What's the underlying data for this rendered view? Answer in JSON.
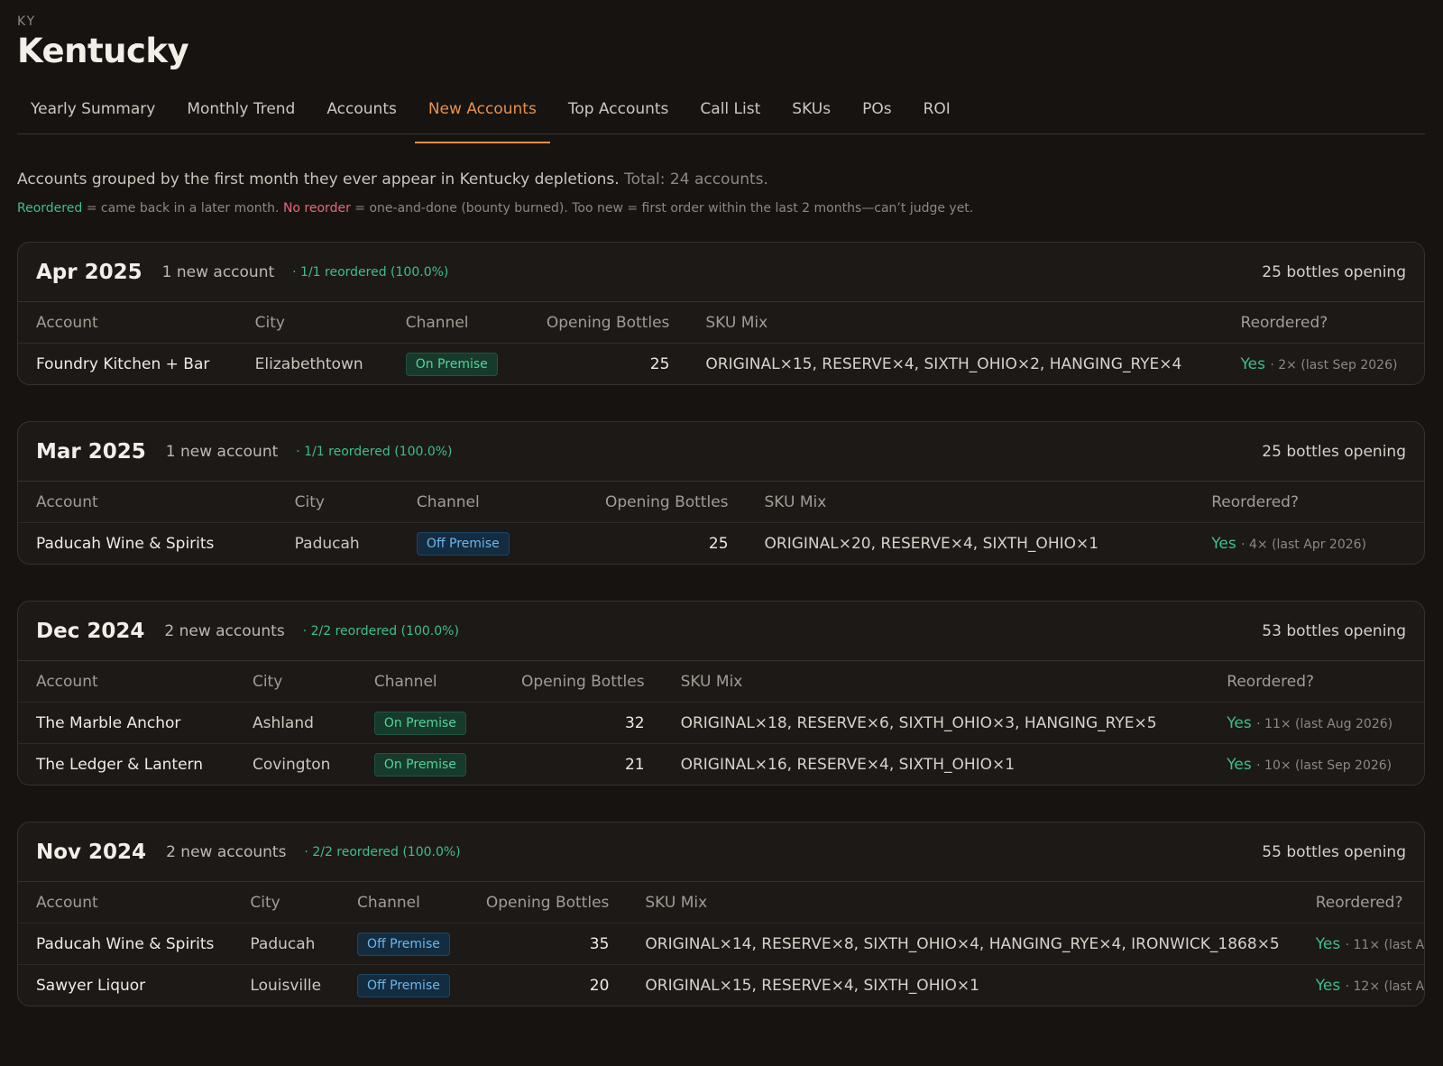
{
  "state": {
    "abbr": "KY",
    "name": "Kentucky"
  },
  "tabs": [
    {
      "label": "Yearly Summary",
      "active": false
    },
    {
      "label": "Monthly Trend",
      "active": false
    },
    {
      "label": "Accounts",
      "active": false
    },
    {
      "label": "New Accounts",
      "active": true
    },
    {
      "label": "Top Accounts",
      "active": false
    },
    {
      "label": "Call List",
      "active": false
    },
    {
      "label": "SKUs",
      "active": false
    },
    {
      "label": "POs",
      "active": false
    },
    {
      "label": "ROI",
      "active": false
    }
  ],
  "intro": {
    "text": "Accounts grouped by the first month they ever appear in Kentucky depletions.",
    "total": "Total: 24 accounts."
  },
  "legend": {
    "reordered": "Reordered",
    "reordered_desc": " = came back in a later month. ",
    "no_reorder": "No reorder",
    "no_reorder_desc": " = one-and-done (bounty burned). Too new = first order within the last 2 months—can’t judge yet."
  },
  "columns": {
    "account": "Account",
    "city": "City",
    "channel": "Channel",
    "opening": "Opening Bottles",
    "sku": "SKU Mix",
    "reordered": "Reordered?"
  },
  "colors": {
    "accent": "#e8904a",
    "green": "#3fbf87",
    "red": "#e8687a"
  },
  "groups": [
    {
      "month": "Apr 2025",
      "count": "1 new account",
      "reordered": "· 1/1 reordered (100.0%)",
      "bottles": "25 bottles opening",
      "rows": [
        {
          "account": "Foundry Kitchen + Bar",
          "city": "Elizabethtown",
          "channel": "On Premise",
          "channel_type": "on",
          "opening": "25",
          "sku": "ORIGINAL×15, RESERVE×4, SIXTH_OHIO×2, HANGING_RYE×4",
          "yes": "Yes",
          "detail": "· 2× (last Sep 2026)"
        }
      ]
    },
    {
      "month": "Mar 2025",
      "count": "1 new account",
      "reordered": "· 1/1 reordered (100.0%)",
      "bottles": "25 bottles opening",
      "rows": [
        {
          "account": "Paducah Wine & Spirits",
          "city": "Paducah",
          "channel": "Off Premise",
          "channel_type": "off",
          "opening": "25",
          "sku": "ORIGINAL×20, RESERVE×4, SIXTH_OHIO×1",
          "yes": "Yes",
          "detail": "· 4× (last Apr 2026)"
        }
      ]
    },
    {
      "month": "Dec 2024",
      "count": "2 new accounts",
      "reordered": "· 2/2 reordered (100.0%)",
      "bottles": "53 bottles opening",
      "rows": [
        {
          "account": "The Marble Anchor",
          "city": "Ashland",
          "channel": "On Premise",
          "channel_type": "on",
          "opening": "32",
          "sku": "ORIGINAL×18, RESERVE×6, SIXTH_OHIO×3, HANGING_RYE×5",
          "yes": "Yes",
          "detail": "· 11× (last Aug 2026)"
        },
        {
          "account": "The Ledger & Lantern",
          "city": "Covington",
          "channel": "On Premise",
          "channel_type": "on",
          "opening": "21",
          "sku": "ORIGINAL×16, RESERVE×4, SIXTH_OHIO×1",
          "yes": "Yes",
          "detail": "· 10× (last Sep 2026)"
        }
      ]
    },
    {
      "month": "Nov 2024",
      "count": "2 new accounts",
      "reordered": "· 2/2 reordered (100.0%)",
      "bottles": "55 bottles opening",
      "rows": [
        {
          "account": "Paducah Wine & Spirits",
          "city": "Paducah",
          "channel": "Off Premise",
          "channel_type": "off",
          "opening": "35",
          "sku": "ORIGINAL×14, RESERVE×8, SIXTH_OHIO×4, HANGING_RYE×4, IRONWICK_1868×5",
          "yes": "Yes",
          "detail": "· 11× (last A"
        },
        {
          "account": "Sawyer Liquor",
          "city": "Louisville",
          "channel": "Off Premise",
          "channel_type": "off",
          "opening": "20",
          "sku": "ORIGINAL×15, RESERVE×4, SIXTH_OHIO×1",
          "yes": "Yes",
          "detail": "· 12× (last A"
        }
      ]
    }
  ]
}
